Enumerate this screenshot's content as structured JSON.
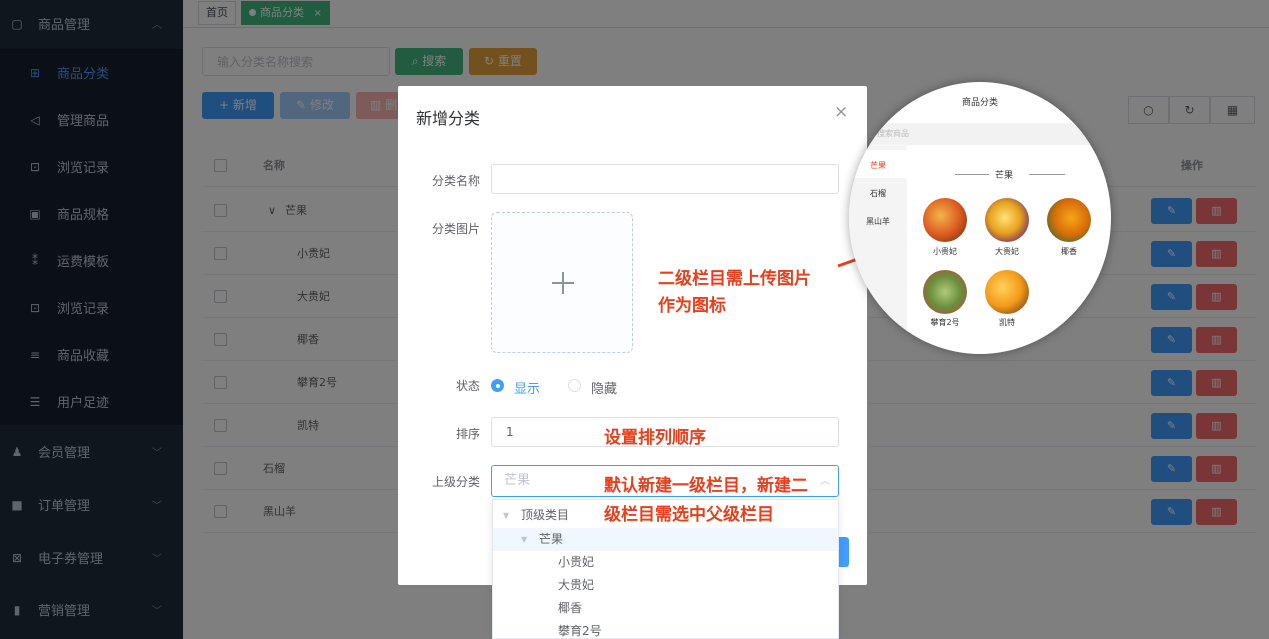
{
  "sidebar": {
    "items": [
      {
        "label": "商品管理",
        "icon": "goods-icon",
        "expanded": true
      },
      {
        "label": "商品分类",
        "icon": "category-icon",
        "active": true
      },
      {
        "label": "管理商品",
        "icon": "send-icon"
      },
      {
        "label": "浏览记录",
        "icon": "browse-icon"
      },
      {
        "label": "商品规格",
        "icon": "spec-icon"
      },
      {
        "label": "运费模板",
        "icon": "freight-icon"
      },
      {
        "label": "浏览记录",
        "icon": "browse-icon"
      },
      {
        "label": "商品收藏",
        "icon": "list-icon"
      },
      {
        "label": "用户足迹",
        "icon": "list-icon"
      },
      {
        "label": "会员管理",
        "icon": "user-icon"
      },
      {
        "label": "订单管理",
        "icon": "lock-icon"
      },
      {
        "label": "电子券管理",
        "icon": "coupon-icon"
      },
      {
        "label": "营销管理",
        "icon": "chart-icon"
      }
    ]
  },
  "tags": {
    "home": "首页",
    "current": "商品分类",
    "close": "×"
  },
  "search": {
    "placeholder": "输入分类名称搜索",
    "search_btn": "搜索",
    "reset_btn": "重置"
  },
  "toolbar": {
    "add": "新增",
    "edit": "修改",
    "delete": "删"
  },
  "table": {
    "col_name": "名称",
    "col_ops": "操作",
    "rows": [
      {
        "name": "芒果",
        "level": 0,
        "expand": "∨"
      },
      {
        "name": "小贵妃",
        "level": 1
      },
      {
        "name": "大贵妃",
        "level": 1
      },
      {
        "name": "椰香",
        "level": 1
      },
      {
        "name": "攀育2号",
        "level": 1
      },
      {
        "name": "凯特",
        "level": 1
      },
      {
        "name": "石榴",
        "level": 0
      },
      {
        "name": "黑山羊",
        "level": 0
      }
    ]
  },
  "dialog": {
    "title": "新增分类",
    "close": "×",
    "name_label": "分类名称",
    "image_label": "分类图片",
    "status_label": "状态",
    "status_show": "显示",
    "status_hide": "隐藏",
    "sort_label": "排序",
    "sort_value": "1",
    "parent_label": "上级分类",
    "parent_value": "芒果"
  },
  "annotations": {
    "upload_line1": "二级栏目需上传图片",
    "upload_line2": "作为图标",
    "sort": "设置排列顺序",
    "parent_line1": "默认新建一级栏目，新建二",
    "parent_line2": "级栏目需选中父级栏目"
  },
  "dropdown": [
    {
      "label": "顶级类目",
      "level": 0,
      "caret": true
    },
    {
      "label": "芒果",
      "level": 1,
      "caret": true,
      "highlight": true
    },
    {
      "label": "小贵妃",
      "level": 2
    },
    {
      "label": "大贵妃",
      "level": 2
    },
    {
      "label": "椰香",
      "level": 2
    },
    {
      "label": "攀育2号",
      "level": 2
    }
  ],
  "preview": {
    "title": "商品分类",
    "search": "搜索商品",
    "categories": [
      "芒果",
      "石榴",
      "黑山羊"
    ],
    "heading": "芒果",
    "fruits": [
      "小贵妃",
      "大贵妃",
      "椰香",
      "攀育2号",
      "凯特"
    ]
  },
  "colors": {
    "sidebar_bg": "#1f2d3d",
    "primary": "#409eff",
    "success": "#42b983",
    "danger": "#f56c6c",
    "warning": "#e6a23c",
    "annotation": "#e8401c"
  }
}
